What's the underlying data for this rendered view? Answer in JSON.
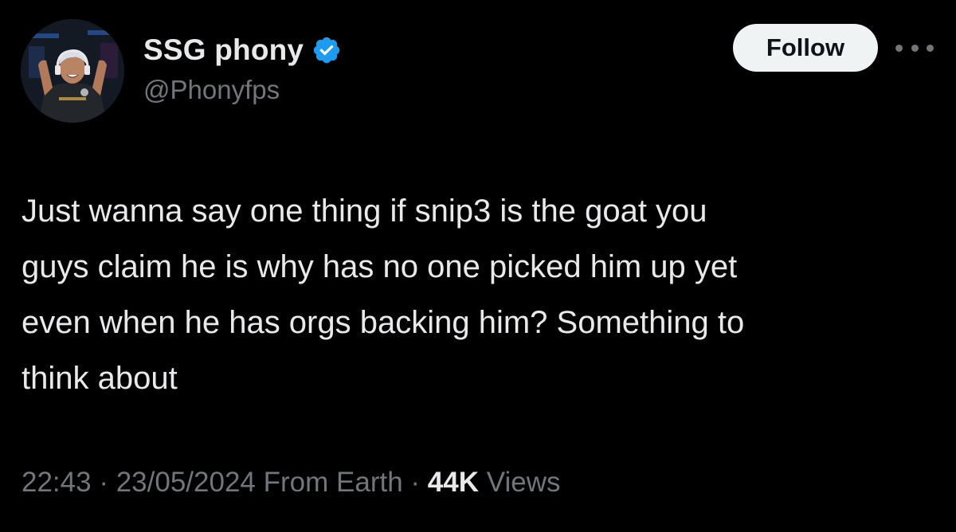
{
  "author": {
    "display_name": "SSG phony",
    "handle": "@Phonyfps",
    "verified_icon": "verified-badge-icon",
    "verified_color": "#1d9bf0"
  },
  "actions": {
    "follow_label": "Follow",
    "more_icon": "more-options-icon"
  },
  "tweet": {
    "lines": [
      "Just wanna say one thing if snip3 is the goat you",
      "guys claim he is why has no one picked him up yet",
      "even when he has orgs backing him? Something to",
      "think about"
    ]
  },
  "meta": {
    "time": "22:43",
    "separator": "·",
    "date": "23/05/2024",
    "source": "From Earth",
    "views_count": "44K",
    "views_label": "Views"
  },
  "colors": {
    "background": "#000000",
    "primary_text": "#e7e9ea",
    "secondary_text": "#71767b",
    "follow_bg": "#eff3f4",
    "follow_text": "#0f1419"
  }
}
